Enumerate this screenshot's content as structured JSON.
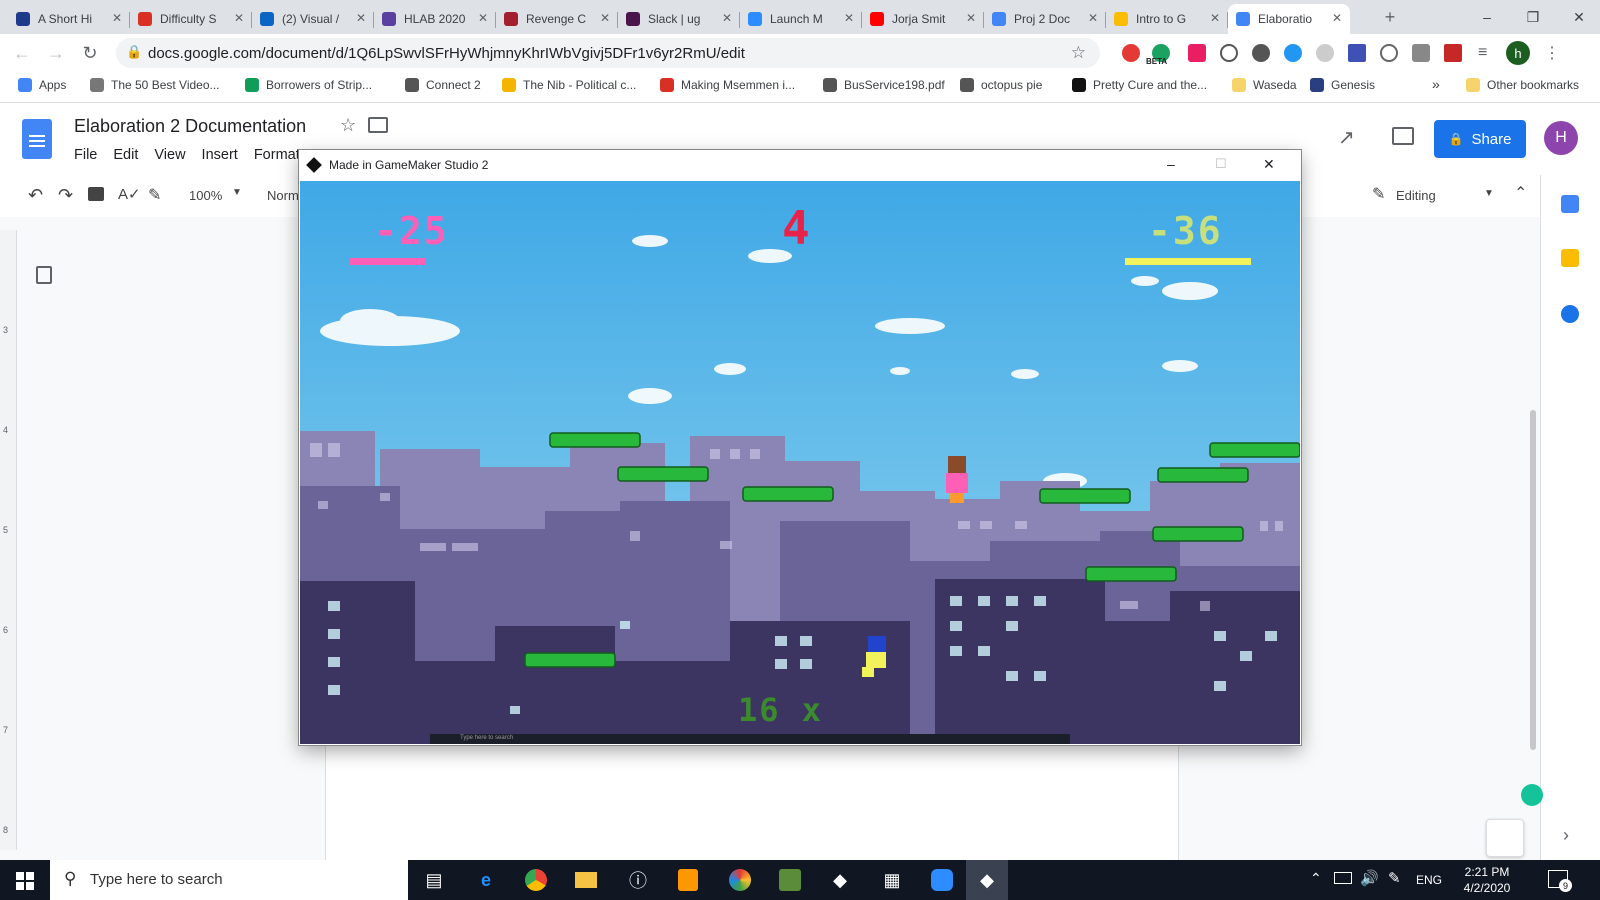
{
  "browser": {
    "tabs": [
      {
        "title": "A Short Hi",
        "color": "#1e3a8a"
      },
      {
        "title": "Difficulty S",
        "color": "#d93025"
      },
      {
        "title": "(2) Visual /",
        "color": "#0a66c2"
      },
      {
        "title": "HLAB 2020",
        "color": "#5b3fa0"
      },
      {
        "title": "Revenge C",
        "color": "#a31f2e"
      },
      {
        "title": "Slack | ug",
        "color": "#4a154b"
      },
      {
        "title": "Launch M",
        "color": "#2d8cff"
      },
      {
        "title": "Jorja Smit",
        "color": "#ff0000"
      },
      {
        "title": "Proj 2 Doc",
        "color": "#4285f4"
      },
      {
        "title": "Intro to G",
        "color": "#fbbc04"
      },
      {
        "title": "Elaboratio",
        "color": "#4285f4"
      }
    ],
    "url": "docs.google.com/document/d/1Q6LpSwvlSFrHyWhjmnyKhrIWbVgivj5DFr1v6yr2RmU/edit",
    "profile_initial": "h",
    "ext_badge": "BETA",
    "bookmarks": [
      {
        "label": "Apps",
        "color": "#4285f4"
      },
      {
        "label": "The 50 Best Video...",
        "color": "#777"
      },
      {
        "label": "Borrowers of Strip...",
        "color": "#0f9d58"
      },
      {
        "label": "Connect 2",
        "color": "#555"
      },
      {
        "label": "The Nib - Political c...",
        "color": "#f4b400"
      },
      {
        "label": "Making Msemmen i...",
        "color": "#d93025"
      },
      {
        "label": "BusService198.pdf",
        "color": "#555"
      },
      {
        "label": "octopus pie",
        "color": "#555"
      },
      {
        "label": "Pretty Cure and the...",
        "color": "#111"
      },
      {
        "label": "Waseda",
        "color": "#f6d36b"
      },
      {
        "label": "Genesis",
        "color": "#2a3f7f"
      }
    ],
    "more_bookmarks": "»",
    "other_bookmarks": "Other bookmarks"
  },
  "docs": {
    "title": "Elaboration 2 Documentation",
    "menu": [
      "File",
      "Edit",
      "View",
      "Insert",
      "Format"
    ],
    "zoom": "100%",
    "style": "Norm",
    "editing": "Editing",
    "share": "Share",
    "user_initial": "H",
    "ruler_marks": [
      "3",
      "4",
      "5",
      "6",
      "7",
      "8"
    ]
  },
  "game": {
    "window_title": "Made in GameMaker Studio 2",
    "score_left": "-25",
    "score_center": "4",
    "score_right": "-36",
    "combo": "16 x",
    "colors": {
      "left": "#ff5fb4",
      "center": "#e8234a",
      "right": "#f2f25a",
      "combo": "#3c8a2e",
      "platform": "#27b83c",
      "sky_top": "#3fa8e6",
      "sky_bottom": "#93d6ef"
    },
    "taskbar_search": "Type here to search"
  },
  "taskbar": {
    "search_placeholder": "Type here to search",
    "language": "ENG",
    "time": "2:21 PM",
    "date": "4/2/2020",
    "notifications": "9"
  }
}
